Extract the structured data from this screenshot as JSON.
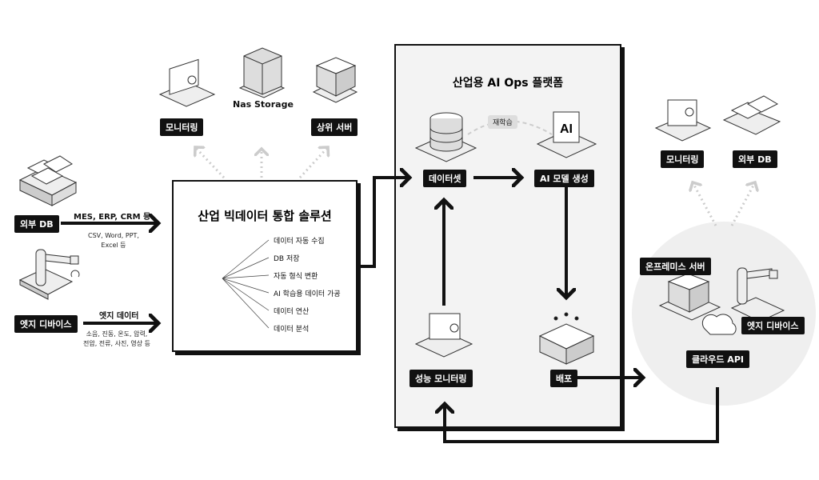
{
  "left": {
    "external_db": "외부 DB",
    "external_db_top": "MES, ERP, CRM 등",
    "external_db_bottom": "CSV, Word, PPT,\nExcel 등",
    "edge_device": "엣지 디바이스",
    "edge_top": "엣지 데이터",
    "edge_bottom": "소음, 진동, 온도, 압력,\n전압, 전류, 사진, 영상 등"
  },
  "top_outputs": {
    "monitoring": "모니터링",
    "nas": "Nas Storage",
    "upper_server": "상위 서버"
  },
  "solution": {
    "title": "산업 빅데이터 통합 솔루션",
    "features": [
      "데이터 자동 수집",
      "DB 저장",
      "자동 형식 변환",
      "AI 학습용 데이터 가공",
      "데이터 연산",
      "데이터 분석"
    ]
  },
  "platform": {
    "title": "산업용 AI Ops 플랫폼",
    "dataset": "데이터셋",
    "retrain": "재학습",
    "model": "AI 모델 생성",
    "ai_chip": "AI",
    "monitoring": "성능 모니터링",
    "deploy": "배포"
  },
  "right": {
    "monitoring": "모니터링",
    "external_db": "외부 DB",
    "onprem": "온프레미스 서버",
    "edge": "엣지 디바이스",
    "cloud": "클라우드 API"
  }
}
